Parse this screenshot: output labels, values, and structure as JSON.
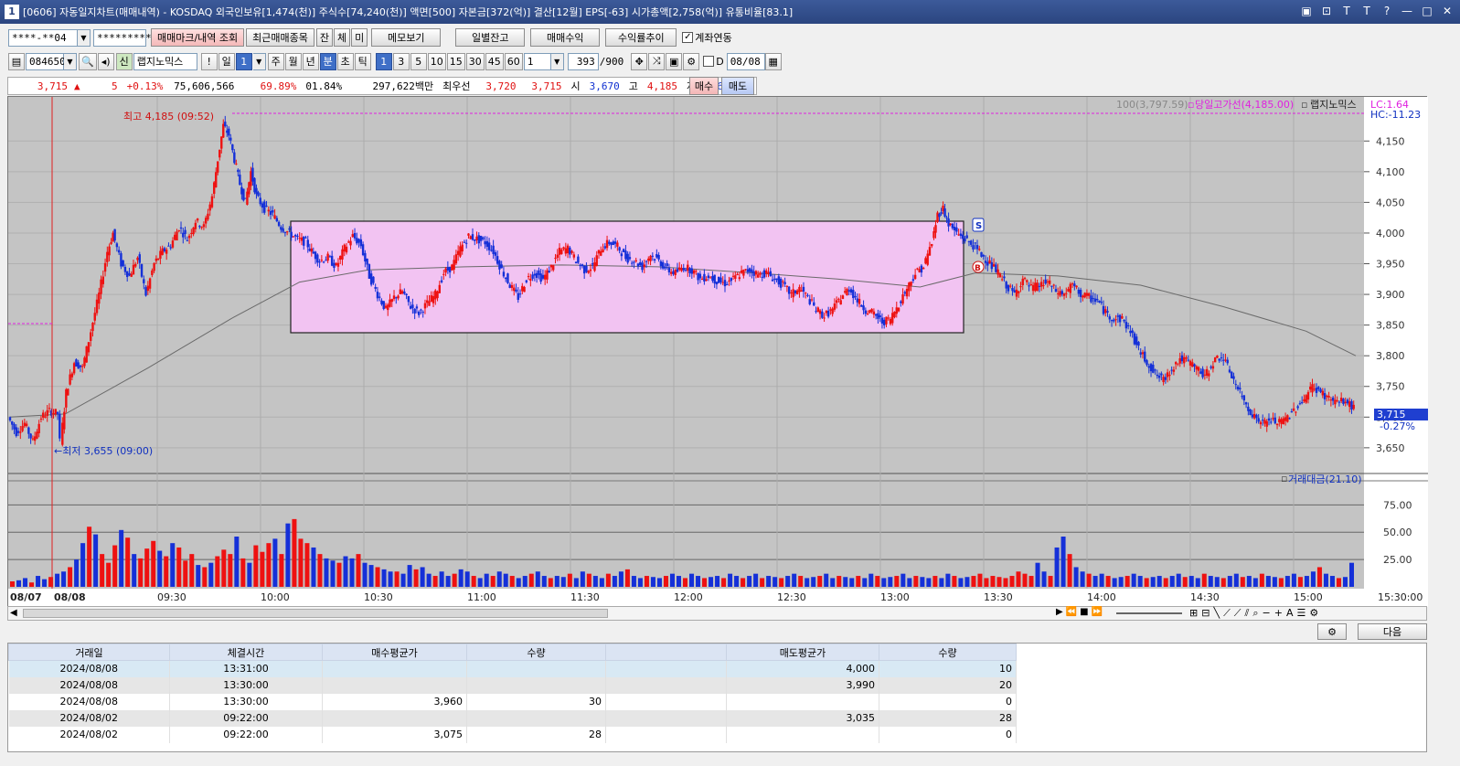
{
  "window": {
    "title": "[0606] 자동일지차트(매매내역) - KOSDAQ 외국인보유[1,474(천)] 주식수[74,240(천)] 액면[500] 자본금[372(억)] 결산[12월] EPS[-63] 시가총액[2,758(억)] 유통비율[83.1]",
    "app_icon": "1",
    "buttons": [
      "▣",
      "⊡",
      "T",
      "T",
      "?",
      "—",
      "□",
      "✕"
    ]
  },
  "toolbar1": {
    "account": "****-**04",
    "password": "*********",
    "btn_trades": "매매마크/내역 조회",
    "btn_recent": "최근매매종목",
    "btn_jan": "잔",
    "btn_che": "체",
    "btn_mi": "미",
    "btn_memo": "메모보기",
    "btn_daily": "일별잔고",
    "btn_profit": "매매수익",
    "btn_rate": "수익률추이",
    "link_label": "계좌연동",
    "link_checked": true
  },
  "toolbar2": {
    "code": "084650",
    "stock_name": "랩지노믹스",
    "stock_badge": "신",
    "periods": [
      "일",
      "1",
      "주",
      "월",
      "년",
      "분",
      "초",
      "틱"
    ],
    "minutes": [
      "1",
      "3",
      "5",
      "10",
      "15",
      "30",
      "45",
      "60"
    ],
    "interval_value": "1",
    "count": "393",
    "count_max": "/900",
    "date_label": "D",
    "date": "08/08"
  },
  "quote": {
    "price": "3,715",
    "arrow": "▲",
    "change": "5",
    "change_pct": "+0.13%",
    "volume": "75,606,566",
    "ratio1": "69.89%",
    "ratio2": "01.84%",
    "amount": "297,622백만",
    "best_label": "최우선",
    "best_ask": "3,720",
    "best_bid": "3,715",
    "open_label": "시",
    "open": "3,670",
    "high_label": "고",
    "high": "4,185",
    "low_label": "저",
    "low": "3,655",
    "buy_btn": "매수",
    "sell_btn": "매도"
  },
  "chart_legend": {
    "ma": "100(3,797.59)",
    "high_line": "당일고가선(4,185.00)",
    "name": "랩지노믹스",
    "lc": "LC:1.64",
    "hc": "HC:-11.23",
    "high_marker": "최고 4,185 (09:52)",
    "low_marker": "←최저 3,655 (09:00)",
    "current_price": "3,715",
    "current_pct": "-0.27%",
    "volume_legend": "거래대금(21.10)",
    "sell_mark": "S",
    "buy_mark": "B"
  },
  "chart_data": {
    "type": "candlestick",
    "y_ticks": [
      "4,150",
      "4,100",
      "4,050",
      "4,000",
      "3,950",
      "3,900",
      "3,850",
      "3,800",
      "3,750",
      "3,700",
      "3,650"
    ],
    "ylim": [
      3620,
      4210
    ],
    "volume_ticks": [
      "75.00",
      "50.00",
      "25.00"
    ],
    "volume_ylim": [
      0,
      92
    ],
    "x_labels": [
      "08/07",
      "08/08",
      "09:30",
      "10:00",
      "10:30",
      "11:00",
      "11:30",
      "12:00",
      "12:30",
      "13:00",
      "13:30",
      "14:00",
      "14:30",
      "15:00",
      "15:30:00"
    ],
    "price_path": [
      [
        0,
        3700
      ],
      [
        6,
        3675
      ],
      [
        12,
        3690
      ],
      [
        18,
        3660
      ],
      [
        24,
        3700
      ],
      [
        30,
        3710
      ],
      [
        36,
        3706
      ],
      [
        38,
        3660
      ],
      [
        42,
        3740
      ],
      [
        48,
        3790
      ],
      [
        54,
        3780
      ],
      [
        60,
        3840
      ],
      [
        66,
        3900
      ],
      [
        72,
        3970
      ],
      [
        76,
        4000
      ],
      [
        82,
        3950
      ],
      [
        88,
        3930
      ],
      [
        94,
        3960
      ],
      [
        100,
        3900
      ],
      [
        106,
        3950
      ],
      [
        112,
        3970
      ],
      [
        118,
        3980
      ],
      [
        124,
        4010
      ],
      [
        130,
        3990
      ],
      [
        136,
        4020
      ],
      [
        142,
        4010
      ],
      [
        148,
        4060
      ],
      [
        152,
        4120
      ],
      [
        156,
        4175
      ],
      [
        160,
        4160
      ],
      [
        164,
        4120
      ],
      [
        168,
        4080
      ],
      [
        172,
        4050
      ],
      [
        176,
        4100
      ],
      [
        180,
        4060
      ],
      [
        186,
        4040
      ],
      [
        192,
        4030
      ],
      [
        198,
        4010
      ],
      [
        204,
        4000
      ],
      [
        210,
        3990
      ],
      [
        216,
        3985
      ],
      [
        220,
        3970
      ],
      [
        226,
        3955
      ],
      [
        232,
        3960
      ],
      [
        238,
        3945
      ],
      [
        244,
        3975
      ],
      [
        250,
        3995
      ],
      [
        256,
        3980
      ],
      [
        262,
        3930
      ],
      [
        268,
        3900
      ],
      [
        274,
        3875
      ],
      [
        280,
        3895
      ],
      [
        286,
        3905
      ],
      [
        292,
        3880
      ],
      [
        298,
        3870
      ],
      [
        304,
        3885
      ],
      [
        310,
        3900
      ],
      [
        316,
        3935
      ],
      [
        322,
        3945
      ],
      [
        328,
        3975
      ],
      [
        334,
        3995
      ],
      [
        340,
        3990
      ],
      [
        346,
        3985
      ],
      [
        352,
        3970
      ],
      [
        358,
        3940
      ],
      [
        364,
        3915
      ],
      [
        370,
        3895
      ],
      [
        376,
        3925
      ],
      [
        382,
        3935
      ],
      [
        388,
        3925
      ],
      [
        394,
        3945
      ],
      [
        400,
        3970
      ],
      [
        406,
        3975
      ],
      [
        412,
        3955
      ],
      [
        418,
        3940
      ],
      [
        424,
        3945
      ],
      [
        430,
        3975
      ],
      [
        436,
        3985
      ],
      [
        442,
        3978
      ],
      [
        448,
        3960
      ],
      [
        454,
        3955
      ],
      [
        460,
        3945
      ],
      [
        466,
        3965
      ],
      [
        472,
        3955
      ],
      [
        478,
        3940
      ],
      [
        484,
        3935
      ],
      [
        490,
        3945
      ],
      [
        496,
        3940
      ],
      [
        502,
        3925
      ],
      [
        508,
        3930
      ],
      [
        514,
        3922
      ],
      [
        520,
        3918
      ],
      [
        526,
        3925
      ],
      [
        532,
        3935
      ],
      [
        538,
        3940
      ],
      [
        544,
        3932
      ],
      [
        550,
        3935
      ],
      [
        556,
        3925
      ],
      [
        562,
        3915
      ],
      [
        568,
        3900
      ],
      [
        574,
        3910
      ],
      [
        580,
        3895
      ],
      [
        586,
        3875
      ],
      [
        592,
        3865
      ],
      [
        598,
        3875
      ],
      [
        604,
        3895
      ],
      [
        610,
        3910
      ],
      [
        616,
        3890
      ],
      [
        622,
        3875
      ],
      [
        628,
        3868
      ],
      [
        634,
        3855
      ],
      [
        640,
        3860
      ],
      [
        646,
        3885
      ],
      [
        652,
        3910
      ],
      [
        658,
        3935
      ],
      [
        664,
        3945
      ],
      [
        670,
        3985
      ],
      [
        674,
        4030
      ],
      [
        678,
        4040
      ],
      [
        682,
        4015
      ],
      [
        688,
        4000
      ],
      [
        694,
        3990
      ],
      [
        700,
        3980
      ],
      [
        706,
        3965
      ],
      [
        712,
        3950
      ],
      [
        718,
        3935
      ],
      [
        724,
        3915
      ],
      [
        730,
        3900
      ],
      [
        736,
        3925
      ],
      [
        742,
        3910
      ],
      [
        748,
        3915
      ],
      [
        754,
        3920
      ],
      [
        760,
        3905
      ],
      [
        766,
        3900
      ],
      [
        772,
        3915
      ],
      [
        778,
        3900
      ],
      [
        784,
        3895
      ],
      [
        790,
        3890
      ],
      [
        796,
        3870
      ],
      [
        802,
        3860
      ],
      [
        808,
        3860
      ],
      [
        814,
        3840
      ],
      [
        820,
        3810
      ],
      [
        826,
        3790
      ],
      [
        832,
        3770
      ],
      [
        838,
        3760
      ],
      [
        844,
        3780
      ],
      [
        850,
        3795
      ],
      [
        856,
        3790
      ],
      [
        862,
        3780
      ],
      [
        868,
        3765
      ],
      [
        874,
        3790
      ],
      [
        880,
        3800
      ],
      [
        886,
        3775
      ],
      [
        892,
        3745
      ],
      [
        898,
        3720
      ],
      [
        904,
        3700
      ],
      [
        910,
        3690
      ],
      [
        916,
        3695
      ],
      [
        922,
        3690
      ],
      [
        928,
        3700
      ],
      [
        934,
        3715
      ],
      [
        940,
        3730
      ],
      [
        946,
        3750
      ],
      [
        952,
        3740
      ],
      [
        958,
        3730
      ],
      [
        964,
        3725
      ],
      [
        970,
        3725
      ],
      [
        976,
        3715
      ]
    ],
    "ma100_path": [
      [
        0,
        3700
      ],
      [
        40,
        3705
      ],
      [
        100,
        3780
      ],
      [
        160,
        3860
      ],
      [
        210,
        3920
      ],
      [
        260,
        3940
      ],
      [
        330,
        3945
      ],
      [
        400,
        3948
      ],
      [
        470,
        3945
      ],
      [
        540,
        3935
      ],
      [
        600,
        3925
      ],
      [
        660,
        3912
      ],
      [
        700,
        3935
      ],
      [
        760,
        3930
      ],
      [
        820,
        3915
      ],
      [
        880,
        3880
      ],
      [
        940,
        3840
      ],
      [
        976,
        3800
      ]
    ],
    "x_max": 976,
    "volume_bars": [
      5,
      6,
      8,
      4,
      10,
      7,
      9,
      12,
      14,
      18,
      25,
      40,
      55,
      48,
      30,
      22,
      38,
      52,
      45,
      30,
      26,
      35,
      42,
      33,
      28,
      40,
      36,
      24,
      30,
      20,
      18,
      22,
      28,
      34,
      30,
      46,
      26,
      22,
      38,
      32,
      40,
      44,
      30,
      58,
      62,
      44,
      40,
      36,
      30,
      26,
      24,
      22,
      28,
      26,
      30,
      22,
      20,
      18,
      16,
      14,
      14,
      12,
      20,
      16,
      18,
      12,
      10,
      14,
      10,
      12,
      16,
      14,
      10,
      8,
      12,
      10,
      14,
      12,
      10,
      8,
      10,
      12,
      14,
      10,
      8,
      10,
      9,
      12,
      8,
      14,
      12,
      10,
      8,
      12,
      10,
      14,
      16,
      10,
      8,
      10,
      9,
      8,
      10,
      12,
      10,
      8,
      12,
      10,
      8,
      9,
      10,
      8,
      12,
      10,
      8,
      10,
      12,
      8,
      10,
      9,
      8,
      10,
      12,
      10,
      8,
      9,
      10,
      12,
      8,
      10,
      9,
      8,
      10,
      8,
      12,
      10,
      8,
      9,
      10,
      12,
      8,
      10,
      9,
      8,
      10,
      8,
      12,
      10,
      8,
      9,
      10,
      12,
      8,
      10,
      9,
      8,
      10,
      14,
      12,
      10,
      22,
      14,
      10,
      36,
      46,
      30,
      18,
      14,
      12,
      10,
      12,
      10,
      8,
      9,
      10,
      12,
      10,
      8,
      9,
      10,
      8,
      10,
      12,
      9,
      10,
      8,
      12,
      10,
      9,
      8,
      10,
      12,
      9,
      10,
      8,
      12,
      10,
      9,
      8,
      10,
      12,
      9,
      10,
      14,
      18,
      12,
      10,
      8,
      9,
      22
    ]
  },
  "scroll_tools": {
    "zoom_minus": "−",
    "zoom_plus": "+",
    "text_tool": "A",
    "settings": "⚙",
    "next_btn": "다음"
  },
  "trade_table": {
    "headers": [
      "거래일",
      "체결시간",
      "매수평균가",
      "수량",
      "",
      "매도평균가",
      "수량"
    ],
    "rows": [
      [
        "2024/08/08",
        "13:31:00",
        "",
        "",
        "",
        "4,000",
        "10"
      ],
      [
        "2024/08/08",
        "13:30:00",
        "",
        "",
        "",
        "3,990",
        "20"
      ],
      [
        "2024/08/08",
        "13:30:00",
        "3,960",
        "30",
        "",
        "",
        "0"
      ],
      [
        "2024/08/02",
        "09:22:00",
        "",
        "",
        "",
        "3,035",
        "28"
      ],
      [
        "2024/08/02",
        "09:22:00",
        "3,075",
        "28",
        "",
        "",
        "0"
      ]
    ]
  }
}
